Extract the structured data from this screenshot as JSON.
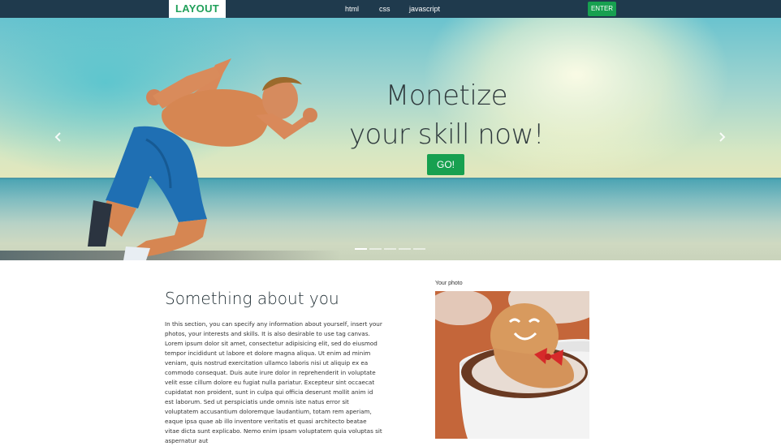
{
  "nav": {
    "logo": "LAYOUT",
    "links": [
      "html",
      "css",
      "javascript"
    ],
    "enter_label": "ENTER"
  },
  "hero": {
    "title_line1": "Monetize",
    "title_line2": "your skill now!",
    "cta_label": "GO!",
    "prev_icon": "chevron-left-icon",
    "next_icon": "chevron-right-icon",
    "slide_count": 5,
    "active_slide": 1
  },
  "about": {
    "title": "Something about you",
    "text": "In this section, you can specify any information about yourself, insert your photos, your interests and skills. It is also desirable to use tag canvas. Lorem ipsum dolor sit amet, consectetur adipisicing elit, sed do eiusmod tempor incididunt ut labore et dolore magna aliqua. Ut enim ad minim veniam, quis nostrud exercitation ullamco laboris nisi ut aliquip ex ea commodo consequat. Duis aute irure dolor in reprehenderit in voluptate velit esse cillum dolore eu fugiat nulla pariatur. Excepteur sint occaecat cupidatat non proident, sunt in culpa qui officia deserunt mollit anim id est laborum. Sed ut perspiciatis unde omnis iste natus error sit voluptatem accusantium doloremque laudantium, totam rem aperiam, eaque ipsa quae ab illo inventore veritatis et quasi architecto beatae vitae dicta sunt explicabo. Nemo enim ipsam voluptatem quia voluptas sit aspernatur aut"
  },
  "photo": {
    "label": "Your photo"
  },
  "colors": {
    "navbar": "#1f3a4d",
    "accent_green": "#17a050",
    "logo_green": "#21a05a"
  }
}
